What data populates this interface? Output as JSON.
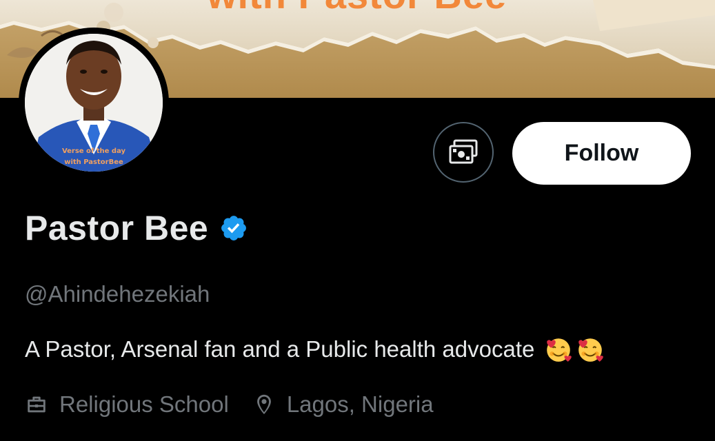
{
  "banner": {
    "title": "with Pastor Bee"
  },
  "avatar": {
    "caption_line1": "Verse of the day",
    "caption_line2": "with PastorBee"
  },
  "actions": {
    "tip_icon": "money-icon",
    "follow_label": "Follow"
  },
  "profile": {
    "display_name": "Pastor Bee",
    "verified_icon": "verified-badge-icon",
    "handle": "@Ahindehezekiah",
    "bio": "A Pastor, Arsenal fan and a Public health advocate",
    "bio_emoji": [
      "smiling-face-with-hearts-emoji",
      "smiling-face-with-hearts-emoji"
    ],
    "meta": {
      "profession_icon": "briefcase-icon",
      "profession": "Religious School",
      "location_icon": "location-pin-icon",
      "location": "Lagos, Nigeria"
    }
  },
  "colors": {
    "background": "#000000",
    "primary_text": "#e7e9ea",
    "secondary_text": "#71767b",
    "verified_blue": "#1d9bf0",
    "banner_accent": "#f2883a"
  }
}
